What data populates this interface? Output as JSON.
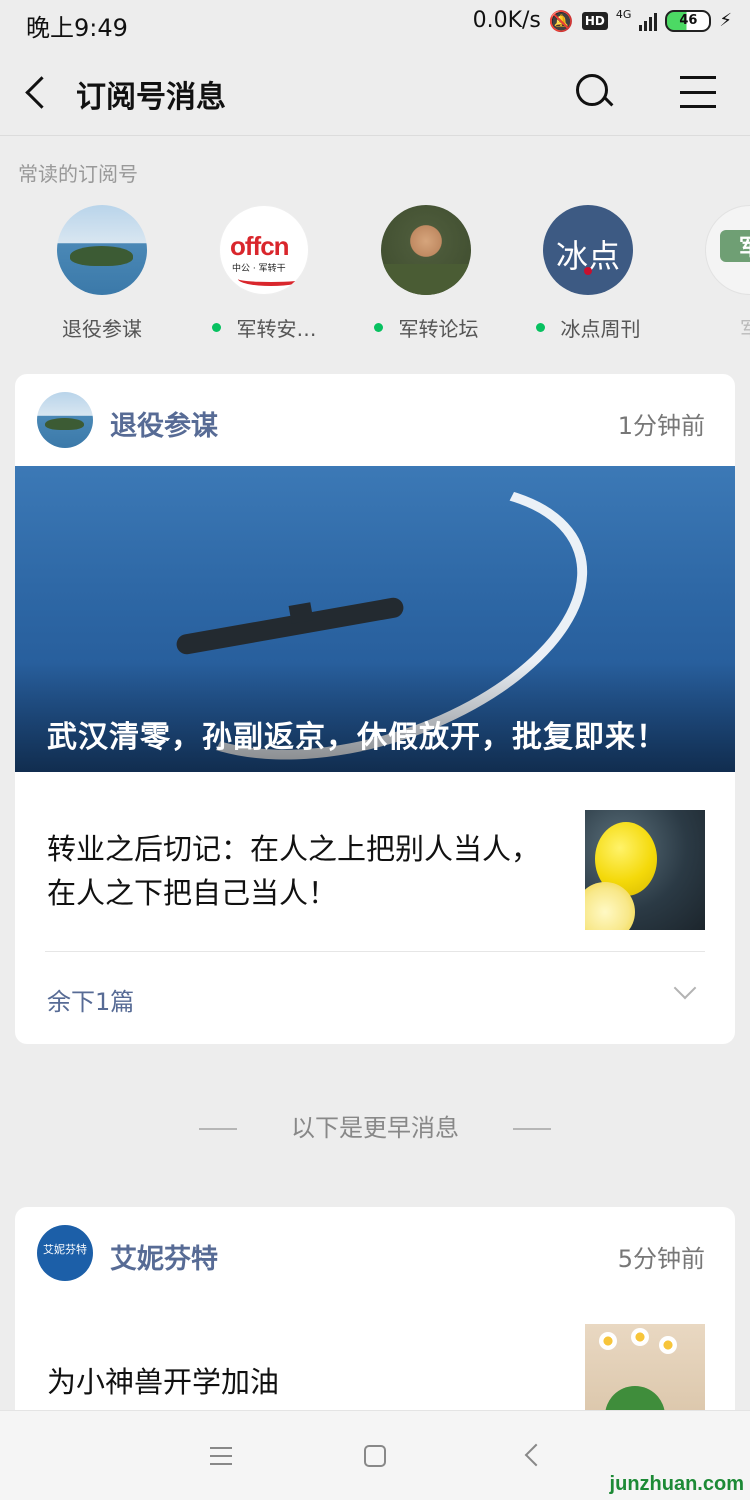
{
  "status_bar": {
    "time": "晚上9:49",
    "network_speed": "0.0K/s",
    "hd_badge": "HD",
    "network_type": "4G",
    "battery_level": "46",
    "icons": [
      "bell-off-icon",
      "signal-icon",
      "battery-icon",
      "charging-icon"
    ]
  },
  "header": {
    "title": "订阅号消息",
    "icons": [
      "back-icon",
      "search-icon",
      "menu-icon"
    ]
  },
  "frequent": {
    "label": "常读的订阅号",
    "items": [
      {
        "name": "退役参谋",
        "unread": false
      },
      {
        "name": "军转安…",
        "unread": true,
        "logo_text": "offcn",
        "logo_sub": "中公 · 军转干"
      },
      {
        "name": "军转论坛",
        "unread": true
      },
      {
        "name": "冰点周刊",
        "unread": true,
        "logo_text": "冰点"
      },
      {
        "name": "军",
        "unread": false,
        "logo_text": "军"
      }
    ]
  },
  "feed": [
    {
      "account": "退役参谋",
      "time": "1分钟前",
      "hero_title": "武汉清零，孙副返京，休假放开，批复即来！",
      "article_title": "转业之后切记：在人之上把别人当人，在人之下把自己当人！",
      "more_label": "余下1篇"
    }
  ],
  "earlier_label": "以下是更早消息",
  "feed_earlier": [
    {
      "account": "艾妮芬特",
      "time": "5分钟前",
      "avatar_text": "艾妮芬特",
      "article_title": "为小神兽开学加油"
    }
  ],
  "watermark": "junzhuan.com",
  "colors": {
    "accent_link": "#576b95",
    "unread_dot": "#07c160",
    "background": "#ededed"
  }
}
